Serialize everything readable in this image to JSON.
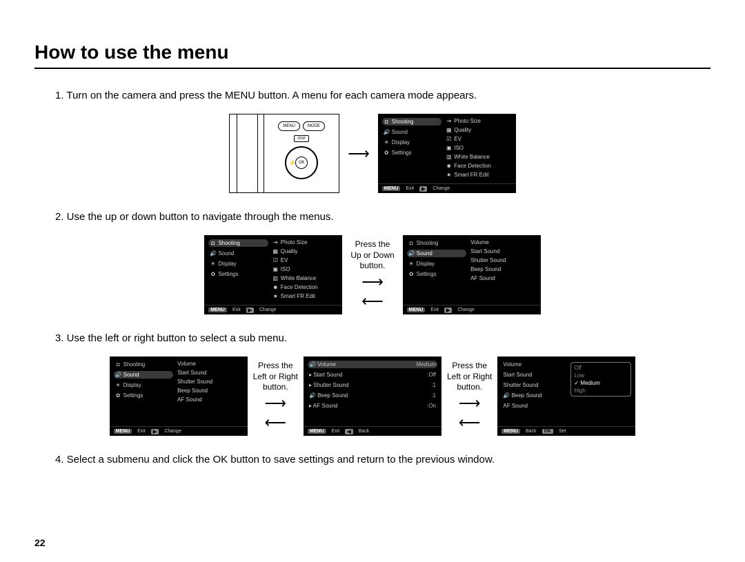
{
  "title": "How to use the menu",
  "page_number": "22",
  "steps": {
    "s1": "1. Turn on the camera and press the MENU button. A menu for each camera mode appears.",
    "s2": "2. Use the up or down button to navigate through the menus.",
    "s3": "3. Use the left or right button to select a sub menu.",
    "s4": "4. Select a submenu and click the OK button to save settings and return to the previous window."
  },
  "camera": {
    "menu": "MENU",
    "mode": "MODE",
    "disp": "DISP",
    "ok": "OK"
  },
  "midlabels": {
    "updown": "Press the\nUp or Down\nbutton.",
    "lr": "Press the\nLeft or Right\nbutton."
  },
  "menu_left": {
    "shooting": "Shooting",
    "sound": "Sound",
    "display": "Display",
    "settings": "Settings"
  },
  "icons": {
    "shooting": "◘",
    "sound": "🔊",
    "display": "☀",
    "settings": "✿",
    "photo": "⇥",
    "quality": "▦",
    "ev": "☑",
    "iso": "▣",
    "wb": "▥",
    "face": "☻",
    "smart": "★"
  },
  "shooting_sub": {
    "photo_size": "Photo Size",
    "quality": "Quality",
    "ev": "EV",
    "iso": "ISO",
    "wb": "White Balance",
    "face": "Face Detection",
    "smart": "Smart FR Edit"
  },
  "sound_sub": {
    "volume": "Volume",
    "start": "Start Sound",
    "shutter": "Shutter Sound",
    "beep": "Beep Sound",
    "af": "AF Sound"
  },
  "sound_values": {
    "volume": "Medium",
    "start": "Off",
    "shutter": "1",
    "beep": "1",
    "af": "On"
  },
  "volume_opts": {
    "off": "Off",
    "low": "Low",
    "medium": "Medium",
    "high": "High"
  },
  "footer": {
    "menu": "MENU",
    "exit": "Exit",
    "change": "Change",
    "back": "Back",
    "ok": "OK",
    "set": "Set"
  }
}
